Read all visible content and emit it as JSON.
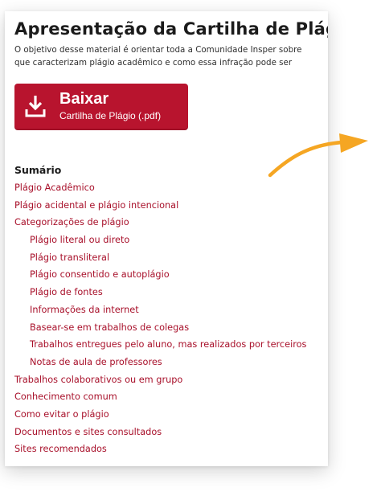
{
  "page": {
    "title": "Apresentação da Cartilha de Plágio",
    "intro_lines": [
      "O objetivo desse material é orientar toda a Comunidade Insper sobre",
      "que caracterizam plágio acadêmico e como essa infração pode ser"
    ]
  },
  "download": {
    "label": "Baixar",
    "sublabel": "Cartilha de Plágio (.pdf)",
    "icon": "download-icon",
    "color": "#b8142e"
  },
  "toc": {
    "heading": "Sumário",
    "items": [
      {
        "label": "Plágio Acadêmico",
        "level": 1
      },
      {
        "label": "Plágio acidental e plágio intencional",
        "level": 1
      },
      {
        "label": "Categorizações de plágio",
        "level": 1
      },
      {
        "label": "Plágio literal ou direto",
        "level": 2
      },
      {
        "label": "Plágio transliteral",
        "level": 2
      },
      {
        "label": "Plágio consentido e autoplágio",
        "level": 2
      },
      {
        "label": "Plágio de fontes",
        "level": 2
      },
      {
        "label": "Informações da internet",
        "level": 2
      },
      {
        "label": "Basear-se em trabalhos de colegas",
        "level": 2
      },
      {
        "label": "Trabalhos entregues pelo aluno, mas realizados por terceiros",
        "level": 2
      },
      {
        "label": "Notas de aula de professores",
        "level": 2
      },
      {
        "label": "Trabalhos colaborativos ou em grupo",
        "level": 1
      },
      {
        "label": "Conhecimento comum",
        "level": 1
      },
      {
        "label": "Como evitar o plágio",
        "level": 1
      },
      {
        "label": "Documentos e sites consultados",
        "level": 1
      },
      {
        "label": "Sites recomendados",
        "level": 1
      }
    ],
    "link_color": "#a8102a"
  },
  "annotation": {
    "icon": "curved-arrow-icon",
    "color": "#f5a623"
  }
}
